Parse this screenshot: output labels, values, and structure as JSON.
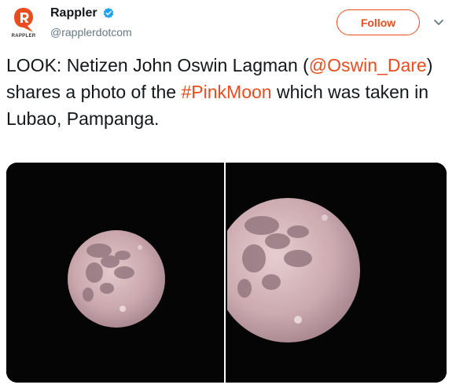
{
  "author": {
    "display_name": "Rappler",
    "handle": "@rapplerdotcom",
    "avatar_word": "RAPPLER",
    "verified": true
  },
  "follow_button": {
    "label": "Follow"
  },
  "menu": {
    "icon": "chevron-down-icon"
  },
  "tweet": {
    "text_before_mention": "LOOK: Netizen John Oswin Lagman (",
    "mention": "@Oswin_Dare",
    "text_after_mention": ") shares a photo of the ",
    "hashtag": "#PinkMoon",
    "text_end": " which was taken in Lubao, Pampanga."
  },
  "media": {
    "photos": [
      {
        "subject": "pink full moon, wide shot"
      },
      {
        "subject": "pink full moon, close-up"
      }
    ]
  },
  "colors": {
    "accent": "#e94d1f",
    "verified": "#1da1f2",
    "text": "#14171a",
    "secondary_text": "#657786"
  }
}
